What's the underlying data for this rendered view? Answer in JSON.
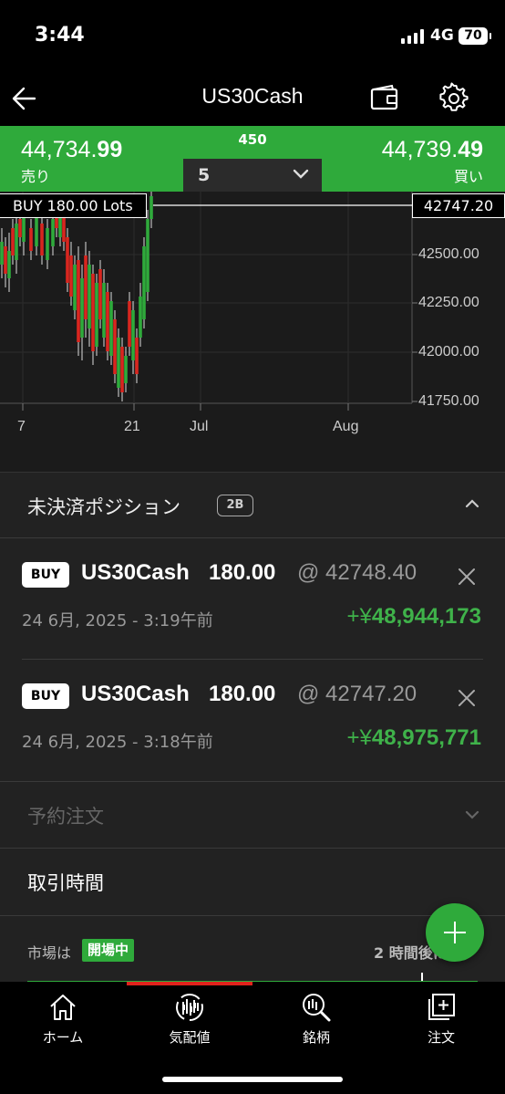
{
  "status_bar": {
    "time": "3:44",
    "network": "4G",
    "battery": "70"
  },
  "header": {
    "title": "US30Cash",
    "back_icon": "back-arrow-icon",
    "wallet_icon": "wallet-icon",
    "settings_icon": "gear-icon"
  },
  "price_bar": {
    "sell_price_main": "44,734.",
    "sell_price_big": "99",
    "sell_label": "売り",
    "buy_price_main": "44,739.",
    "buy_price_big": "49",
    "buy_label": "買い",
    "spread": "450",
    "lot_size": "5"
  },
  "chart": {
    "position_label": "BUY 180.00 Lots",
    "current_price_label": "42747.20",
    "y_ticks": [
      "42500.00",
      "42250.00",
      "42000.00",
      "41750.00"
    ],
    "x_ticks": [
      "7",
      "21",
      "Jul",
      "Aug"
    ],
    "colors": {
      "up": "#2faa3b",
      "down": "#d9261f"
    }
  },
  "chart_data": {
    "type": "candlestick",
    "title": "",
    "ylim": [
      41750,
      42750
    ],
    "x_ticks": [
      "7",
      "21",
      "Jul",
      "Aug"
    ],
    "y_ticks": [
      42500,
      42250,
      42000,
      41750
    ],
    "position_line": 42747.2
  },
  "positions": {
    "title": "未決済ポジション",
    "count": "2B",
    "items": [
      {
        "side": "BUY",
        "symbol": "US30Cash",
        "volume": "180.00",
        "open_price": "@ 42748.40",
        "opened": "24 6月, 2025 - 3:19午前",
        "pnl_prefix": "+¥",
        "pnl": "48,944,173"
      },
      {
        "side": "BUY",
        "symbol": "US30Cash",
        "volume": "180.00",
        "open_price": "@ 42747.20",
        "opened": "24 6月, 2025 - 3:18午前",
        "pnl_prefix": "+¥",
        "pnl": "48,975,771"
      }
    ]
  },
  "pending_orders": {
    "title": "予約注文"
  },
  "trading_hours": {
    "title": "取引時間",
    "market_label": "市場は",
    "market_status": "開場中",
    "next_change": "2 時間後に"
  },
  "nav": {
    "items": [
      {
        "label": "ホーム",
        "icon": "home-icon"
      },
      {
        "label": "気配値",
        "icon": "quotes-icon"
      },
      {
        "label": "銘柄",
        "icon": "symbols-search-icon"
      },
      {
        "label": "注文",
        "icon": "order-icon"
      }
    ]
  }
}
